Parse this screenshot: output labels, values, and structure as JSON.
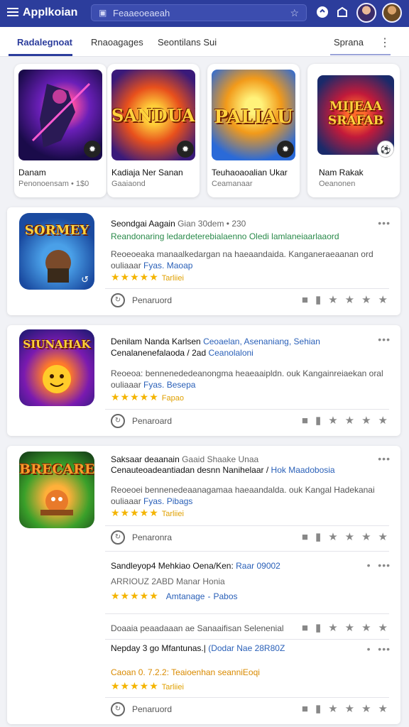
{
  "header": {
    "title": "Applkoian",
    "search_placeholder": "Feaaeoeaeah"
  },
  "tabs": [
    "Radalegnoat",
    "Rnaoagages",
    "Seontilans Sui",
    "Sprana"
  ],
  "featured": [
    {
      "art_text": "SANDUAK",
      "name": "Danam",
      "sub": "Penonoensam • 1$0"
    },
    {
      "art_text": "PALIAU",
      "name": "Kadiaja Ner Sanan",
      "sub": "Gaaiaond"
    },
    {
      "art_text": "MIJEAA SRAFAB",
      "name": "Teuhaoaoalian Ukar",
      "sub": "Ceamanaar"
    },
    {
      "art_text": "",
      "name": "Nam Rakak",
      "sub": "Oeanonen"
    }
  ],
  "cards": [
    {
      "icon_text": "SORMEY",
      "title": "Seondgai Aagain",
      "title_meta": "Gian 30dem • 230",
      "link": "Reandonaring ledardeterebialaenno Oledi lamlaneiaarlaaord",
      "desc": "Reoeoeaka manaalkedargan na haeaandaida. Kanganeraeaanan ord ouliaaar",
      "desc_link": "Fyas. Maoap",
      "star_label": "Tarliiei",
      "action_label": "Penaruord"
    },
    {
      "icon_text": "SIUNAHAK",
      "title": "Denilam Nanda Karlsen",
      "title_blue": "Ceoaelan, Asenaniang, Sehian",
      "title2": "Cenalanenefalaoda / 2ad",
      "title2_blue": "Ceanolaloni",
      "desc": "Reoeoa: bennenededeanongma heaeaaipldn. ouk Kangainreiaekan oral ouliaaar",
      "desc_link": "Fyas. Besepa",
      "star_label": "Fapao",
      "action_label": "Penaroard"
    },
    {
      "icon_text": "BRECARE",
      "title": "Saksaar deaanain",
      "title_meta": "Gaaid Shaake Unaa",
      "title2": "Cenauteoadeantiadan desnn Nanihelaar /",
      "title2_blue": "Hok Maadobosia",
      "desc": "Reoeoei bennenedeaanagamaa haeaandalda. ouk Kangal Hadekanai ouliaaar",
      "desc_link": "Fyas. Pibags",
      "star_label": "Tarliiei",
      "action_label": "Penaronra"
    }
  ],
  "extra": [
    {
      "title": "Sandleyop4 Mehkiao Oena/Ken:",
      "title_blue": "Raar 09002",
      "sub": "ARRIOUZ 2ABD Manar Honia",
      "star_label": "Amtanage",
      "star_label2": "Pabos"
    },
    {
      "row_text": "Doaaia peaadaaan ae Sanaaifisan Selenenial"
    },
    {
      "title": "Nepday 3 go Mfantunas.|",
      "title_blue": "(Dodar Nae 28R80Z",
      "meta": "Caoan 0. 7.2.2: Teaioenhan seanniEoqi",
      "star_label": "Tarliiei",
      "action_label": "Penaruord"
    }
  ],
  "colors": {
    "topbar": "#2c3d9c",
    "accent": "#2c3d9c",
    "star": "#f4b400",
    "link_green": "#2a8a4a",
    "link_blue": "#2a60b8"
  }
}
